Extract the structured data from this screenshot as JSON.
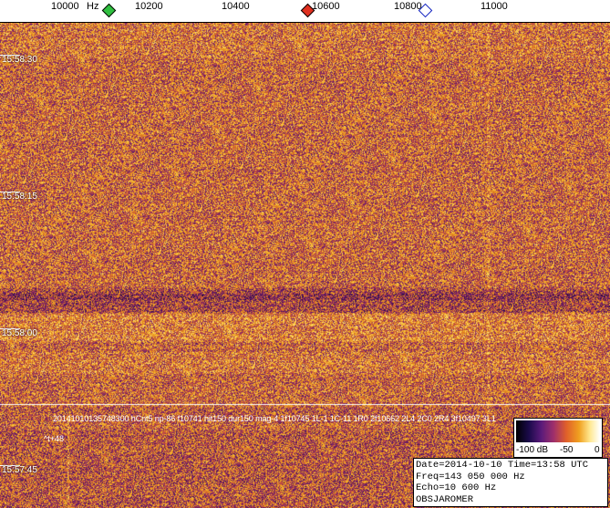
{
  "ruler": {
    "hz_unit": "Hz",
    "ticks": [
      "10000",
      "10200",
      "10400",
      "10600",
      "10800",
      "11000"
    ],
    "markers": [
      {
        "name": "green-marker-icon",
        "color": "#30c040"
      },
      {
        "name": "red-marker-icon",
        "color": "#e03020"
      },
      {
        "name": "blue-marker-icon",
        "color": "#1020c0"
      }
    ]
  },
  "timestamps": [
    "15:58:30",
    "15:58:15",
    "15:58:00",
    "15:57:45"
  ],
  "detection_line": "20141010135748300 hCnt5 np-86 f10741 hit150 dur150 mag-4 1f10745 1L-1 1C-11 1R0 2f10662 2L4 2C0 2R4 3f10497 3L1 ",
  "note": "^t+48",
  "scale": {
    "min_label": "-100 dB",
    "mid_label": "-50",
    "max_label": "0"
  },
  "info": {
    "line1": "Date=2014-10-10 Time=13:58 UTC",
    "line2": "Freq=143 050 000 Hz",
    "line3": "Echo=10 600 Hz",
    "line4": "OBSJAROMER"
  },
  "colors": {
    "background": "#e08a20",
    "dark": "#3a1060",
    "bright": "#ffc840"
  }
}
